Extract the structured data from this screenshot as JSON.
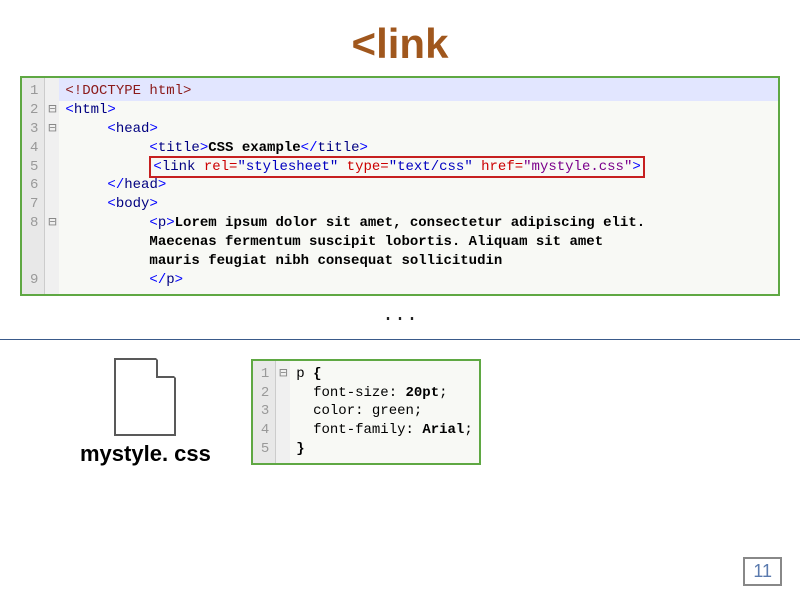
{
  "title": "<link",
  "main_code": {
    "line_numbers": "1\n2\n3\n4\n5\n6\n7\n8\n\n\n9",
    "folds": " \n⊟\n⊟\n \n \n \n \n⊟\n \n \n ",
    "l1": "<!DOCTYPE html>",
    "l2_open": "<",
    "l2_name": "html",
    "l2_close": ">",
    "l3_open": "<",
    "l3_name": "head",
    "l3_close": ">",
    "l4_open": "<",
    "l4_name": "title",
    "l4_close": ">",
    "l4_text": "CSS example",
    "l4_end_open": "</",
    "l4_end_close": ">",
    "l5_open": "<",
    "l5_name": "link",
    "l5_attr1": " rel=",
    "l5_val1": "\"stylesheet\"",
    "l5_attr2": " type=",
    "l5_val2": "\"text/css\"",
    "l5_attr3": " href=",
    "l5_val3": "\"mystyle.css\"",
    "l5_close": ">",
    "l6_open": "</",
    "l6_name": "head",
    "l6_close": ">",
    "l7_open": "<",
    "l7_name": "body",
    "l7_close": ">",
    "l8_open": "<",
    "l8_name": "p",
    "l8_close": ">",
    "l8_text": "Lorem ipsum dolor sit amet, consectetur adipiscing elit.\n          Maecenas fermentum suscipit lobortis. Aliquam sit amet\n          mauris feugiat nibh consequat sollicitudin",
    "l9_open": "</",
    "l9_name": "p",
    "l9_close": ">"
  },
  "ellipsis": "...",
  "file": {
    "label": "mystyle.\ncss"
  },
  "css_code": {
    "line_numbers": "1\n2\n3\n4\n5",
    "folds": "⊟\n \n \n \n ",
    "l1_sel": "p",
    "l1_brace": " {",
    "l2_prop": "  font-size: ",
    "l2_val": "20pt",
    "l2_semi": ";",
    "l3_prop": "  color: ",
    "l3_val": "green",
    "l3_semi": ";",
    "l4_prop": "  font-family: ",
    "l4_val": "Arial",
    "l4_semi": ";",
    "l5": "}"
  },
  "page_number": "11"
}
